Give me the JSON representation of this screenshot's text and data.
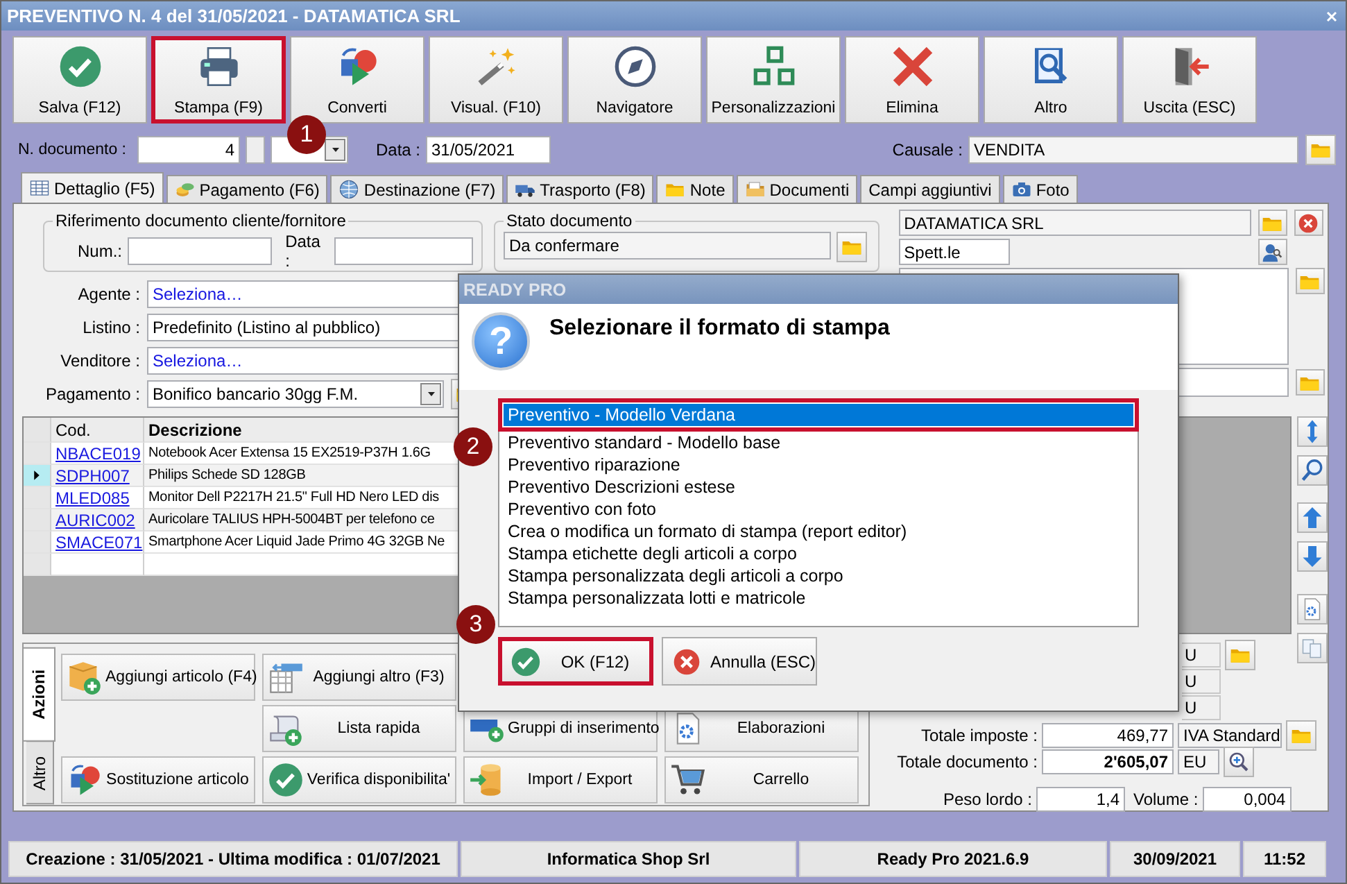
{
  "window": {
    "title": "PREVENTIVO N. 4 del 31/05/2021 - DATAMATICA SRL"
  },
  "toolbar": [
    {
      "label": "Salva (F12)",
      "highlighted": false
    },
    {
      "label": "Stampa (F9)",
      "highlighted": true
    },
    {
      "label": "Converti",
      "highlighted": false
    },
    {
      "label": "Visual. (F10)",
      "highlighted": false
    },
    {
      "label": "Navigatore",
      "highlighted": false
    },
    {
      "label": "Personalizzazioni",
      "highlighted": false
    },
    {
      "label": "Elimina",
      "highlighted": false
    },
    {
      "label": "Altro",
      "highlighted": false
    },
    {
      "label": "Uscita (ESC)",
      "highlighted": false
    }
  ],
  "document": {
    "number_label": "N. documento :",
    "number": "4",
    "date_label": "Data :",
    "date": "31/05/2021",
    "causale_label": "Causale :",
    "causale": "VENDITA"
  },
  "tabs": [
    {
      "label": "Dettaglio (F5)",
      "selected": true
    },
    {
      "label": "Pagamento (F6)",
      "selected": false
    },
    {
      "label": "Destinazione (F7)",
      "selected": false
    },
    {
      "label": "Trasporto (F8)",
      "selected": false
    },
    {
      "label": "Note",
      "selected": false
    },
    {
      "label": "Documenti",
      "selected": false
    },
    {
      "label": "Campi aggiuntivi",
      "selected": false
    },
    {
      "label": "Foto",
      "selected": false
    }
  ],
  "reference": {
    "title": "Riferimento documento cliente/fornitore",
    "num_label": "Num.:",
    "date_label": "Data :"
  },
  "document_status": {
    "title": "Stato documento",
    "value": "Da confermare"
  },
  "fields": [
    {
      "label": "Agente :",
      "value": "Seleziona…",
      "kind": "link"
    },
    {
      "label": "Listino :",
      "value": "Predefinito (Listino al pubblico)",
      "kind": "text"
    },
    {
      "label": "Venditore :",
      "value": "Seleziona…",
      "kind": "link"
    },
    {
      "label": "Pagamento :",
      "value": "Bonifico bancario 30gg F.M.",
      "kind": "combo"
    }
  ],
  "customer": {
    "name": "DATAMATICA SRL",
    "salutation": "Spett.le"
  },
  "table": {
    "columns": [
      "Cod.",
      "Descrizione"
    ],
    "rows": [
      {
        "code": "NBACE019",
        "description": "Notebook Acer Extensa 15 EX2519-P37H 1.6G",
        "selected": false
      },
      {
        "code": "SDPH007",
        "description": "Philips Schede SD 128GB",
        "selected": true
      },
      {
        "code": "MLED085",
        "description": "Monitor Dell P2217H 21.5\" Full HD Nero LED dis",
        "selected": false
      },
      {
        "code": "AURIC002",
        "description": "Auricolare TALIUS HPH-5004BT per telefono ce",
        "selected": false
      },
      {
        "code": "SMACE071",
        "description": "Smartphone Acer Liquid Jade Primo 4G 32GB Ne",
        "selected": false
      }
    ]
  },
  "actions": {
    "tabs": [
      {
        "label": "Azioni",
        "selected": true
      },
      {
        "label": "Altro",
        "selected": false
      }
    ],
    "buttons": [
      "Aggiungi articolo (F4)",
      "Aggiungi altro (F3)",
      "Lista rapida",
      "Gruppi di inserimento",
      "Elaborazioni",
      "Sostituzione articolo",
      "Verifica disponibilita'",
      "Import / Export",
      "Carrello"
    ]
  },
  "totals": {
    "partial_currencies": [
      "U",
      "U",
      "U"
    ],
    "rows": [
      {
        "label": "Totale imposte :",
        "value": "469,77",
        "extra": "IVA Standard"
      },
      {
        "label": "Totale documento :",
        "value": "2'605,07",
        "extra": "EU"
      }
    ],
    "gross_weight_label": "Peso lordo :",
    "gross_weight": "1,4",
    "volume_label": "Volume :",
    "volume": "0,004"
  },
  "status_bar": [
    "Creazione : 31/05/2021 - Ultima modifica : 01/07/2021",
    "Informatica Shop Srl",
    "Ready Pro 2021.6.9",
    "30/09/2021",
    "11:52"
  ],
  "dialog": {
    "title": "READY PRO",
    "icon": "?",
    "message": "Selezionare il formato di stampa",
    "items": [
      {
        "label": "Preventivo - Modello Verdana",
        "selected": true,
        "highlighted": true
      },
      {
        "label": "Preventivo standard - Modello base",
        "selected": false,
        "highlighted": false
      },
      {
        "label": "Preventivo riparazione",
        "selected": false,
        "highlighted": false
      },
      {
        "label": "Preventivo Descrizioni estese",
        "selected": false,
        "highlighted": false
      },
      {
        "label": "Preventivo con foto",
        "selected": false,
        "highlighted": false
      },
      {
        "label": "Crea o modifica un formato di stampa (report editor)",
        "selected": false,
        "highlighted": false
      },
      {
        "label": "Stampa etichette degli articoli a corpo",
        "selected": false,
        "highlighted": false
      },
      {
        "label": "Stampa personalizzata degli articoli a corpo",
        "selected": false,
        "highlighted": false
      },
      {
        "label": "Stampa personalizzata lotti e matricole",
        "selected": false,
        "highlighted": false
      }
    ],
    "buttons": [
      {
        "label": "OK (F12)",
        "highlighted": true
      },
      {
        "label": "Annulla (ESC)",
        "highlighted": false
      }
    ]
  },
  "annotations": [
    "1",
    "2",
    "3"
  ]
}
